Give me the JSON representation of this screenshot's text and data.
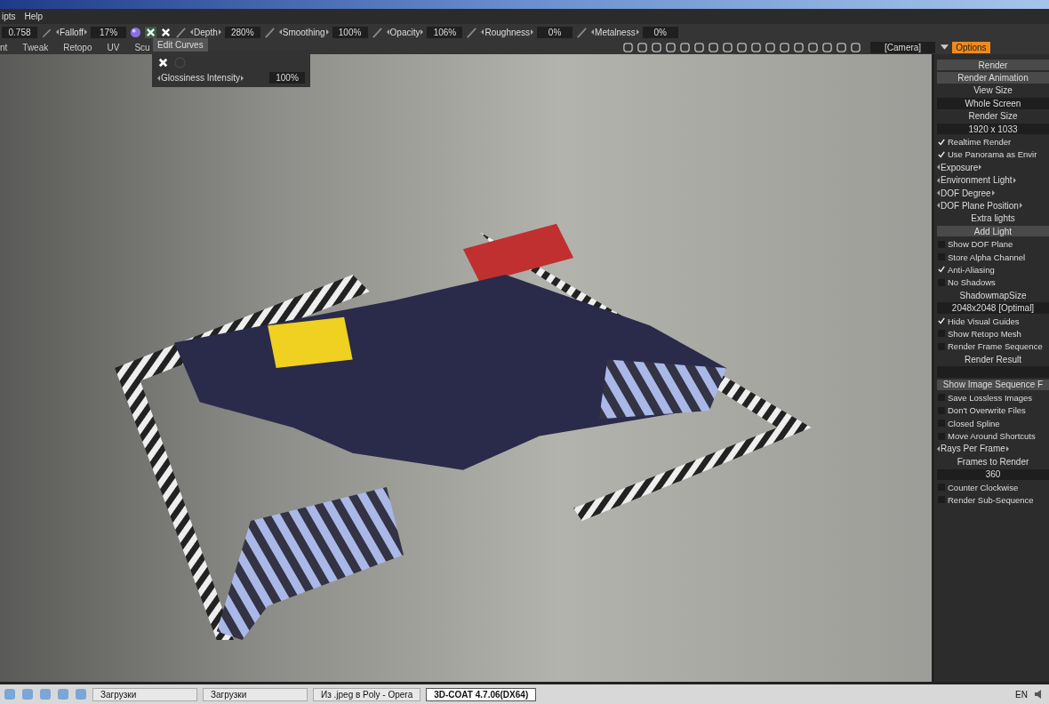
{
  "menu": [
    "ipts",
    "Help"
  ],
  "toolbar": {
    "value": "0.758",
    "params": [
      {
        "label": "Falloff",
        "value": "17%"
      },
      {
        "label": "Depth",
        "value": "280%"
      },
      {
        "label": "Smoothing",
        "value": "100%"
      },
      {
        "label": "Opacity",
        "value": "106%"
      },
      {
        "label": "Roughness",
        "value": "0%"
      },
      {
        "label": "Metalness",
        "value": "0%"
      }
    ]
  },
  "rooms": [
    "nt",
    "Tweak",
    "Retopo",
    "UV",
    "Scu"
  ],
  "tooltip": "Edit Curves",
  "popup": {
    "label": "Glossiness Intensity",
    "value": "100%"
  },
  "camera": "[Camera]",
  "panel_tab": {
    "label": "Options",
    "selected": true
  },
  "panel": [
    {
      "kind": "button",
      "label": "Render"
    },
    {
      "kind": "button",
      "label": "Render Animation"
    },
    {
      "kind": "heading",
      "label": "View Size"
    },
    {
      "kind": "field",
      "label": "Whole Screen"
    },
    {
      "kind": "heading",
      "label": "Render Size"
    },
    {
      "kind": "field",
      "label": "1920 x 1033"
    },
    {
      "kind": "check",
      "label": "Realtime Render",
      "checked": true
    },
    {
      "kind": "check",
      "label": "Use Panorama as Envir",
      "checked": true
    },
    {
      "kind": "param",
      "label": "Exposure"
    },
    {
      "kind": "param",
      "label": "Environment Light"
    },
    {
      "kind": "param",
      "label": "DOF Degree"
    },
    {
      "kind": "param",
      "label": "DOF Plane Position"
    },
    {
      "kind": "heading",
      "label": "Extra lights"
    },
    {
      "kind": "button",
      "label": "Add Light"
    },
    {
      "kind": "check",
      "label": "Show DOF Plane",
      "checked": false
    },
    {
      "kind": "check",
      "label": "Store Alpha Channel",
      "checked": false
    },
    {
      "kind": "check",
      "label": "Anti-Aliasing",
      "checked": true
    },
    {
      "kind": "check",
      "label": "No Shadows",
      "checked": false
    },
    {
      "kind": "heading",
      "label": "ShadowmapSize"
    },
    {
      "kind": "field",
      "label": "2048x2048 [Optimal]"
    },
    {
      "kind": "check",
      "label": "Hide Visual Guides",
      "checked": true
    },
    {
      "kind": "check",
      "label": "Show Retopo Mesh",
      "checked": false
    },
    {
      "kind": "check",
      "label": "Render Frame Sequence",
      "checked": false
    },
    {
      "kind": "heading",
      "label": "Render Result"
    },
    {
      "kind": "field"
    },
    {
      "kind": "button",
      "label": "Show Image Sequence F"
    },
    {
      "kind": "check",
      "label": "Save Lossless Images",
      "checked": false
    },
    {
      "kind": "check",
      "label": "Don't Overwrite Files",
      "checked": false
    },
    {
      "kind": "check",
      "label": "Closed Spline",
      "checked": false
    },
    {
      "kind": "check",
      "label": "Move Around Shortcuts",
      "checked": false
    },
    {
      "kind": "param",
      "label": "Rays Per Frame"
    },
    {
      "kind": "heading",
      "label": "Frames to Render"
    },
    {
      "kind": "field",
      "label": "360"
    },
    {
      "kind": "check",
      "label": "Counter Clockwise",
      "checked": false
    },
    {
      "kind": "check",
      "label": "Render Sub-Sequence",
      "checked": false
    }
  ],
  "taskbar": {
    "tasks": [
      {
        "label": "Загрузки",
        "selected": false
      },
      {
        "label": "Загрузки",
        "selected": false
      },
      {
        "label": "Из .jpeg в Poly - Opera",
        "selected": false
      },
      {
        "label": "3D-COAT 4.7.06(DX64)",
        "selected": true
      }
    ],
    "language": "EN"
  }
}
